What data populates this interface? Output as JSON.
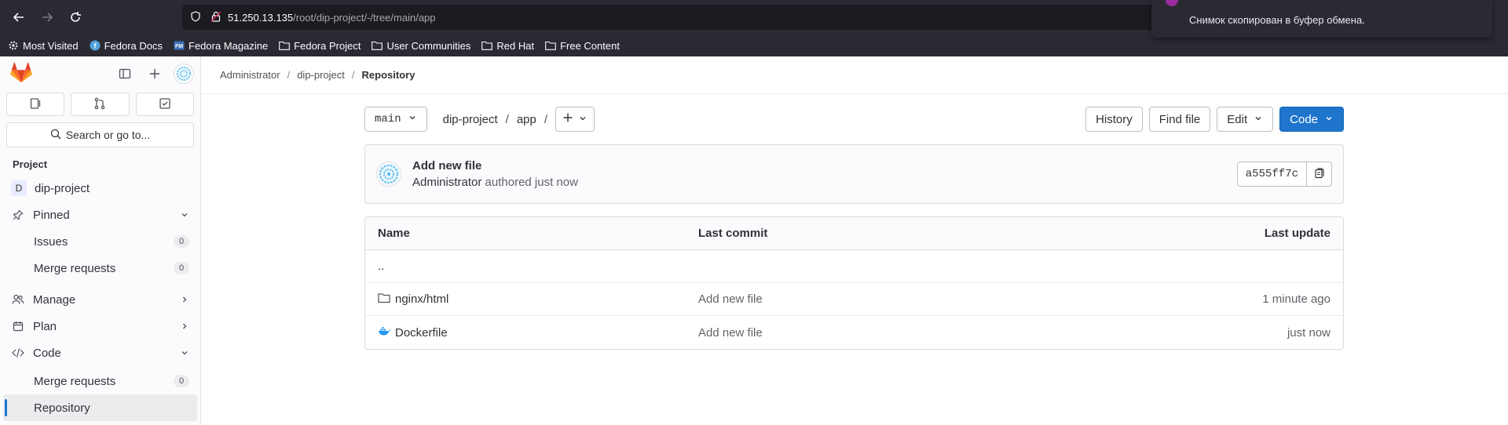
{
  "browser": {
    "url_host": "51.250.13.135",
    "url_path": "/root/dip-project/-/tree/main/app",
    "bookmarks": [
      "Most Visited",
      "Fedora Docs",
      "Fedora Magazine",
      "Fedora Project",
      "User Communities",
      "Red Hat",
      "Free Content"
    ],
    "toast": "Снимок скопирован в буфер обмена."
  },
  "sidebar": {
    "search_label": "Search or go to...",
    "section_title": "Project",
    "project_letter": "D",
    "project_name": "dip-project",
    "items": {
      "pinned": "Pinned",
      "issues": "Issues",
      "issues_count": "0",
      "merge_requests_pinned": "Merge requests",
      "merge_requests_pinned_count": "0",
      "manage": "Manage",
      "plan": "Plan",
      "code": "Code",
      "merge_requests": "Merge requests",
      "merge_requests_count": "0",
      "repository": "Repository"
    }
  },
  "breadcrumb": {
    "items": [
      "Administrator",
      "dip-project"
    ],
    "current": "Repository"
  },
  "toolbar": {
    "branch": "main",
    "path": [
      "dip-project",
      "app"
    ],
    "history": "History",
    "find_file": "Find file",
    "edit": "Edit",
    "code": "Code"
  },
  "commit": {
    "title": "Add new file",
    "author": "Administrator",
    "meta": "authored just now",
    "sha": "a555ff7c"
  },
  "tree": {
    "headers": {
      "name": "Name",
      "last_commit": "Last commit",
      "last_update": "Last update"
    },
    "parent": "..",
    "rows": [
      {
        "name": "nginx/html",
        "type": "folder",
        "commit": "Add new file",
        "updated": "1 minute ago"
      },
      {
        "name": "Dockerfile",
        "type": "docker",
        "commit": "Add new file",
        "updated": "just now"
      }
    ]
  },
  "colors": {
    "accent": "#1f75cb",
    "browser_bg": "#2b2a33",
    "brand": "#e24329"
  }
}
